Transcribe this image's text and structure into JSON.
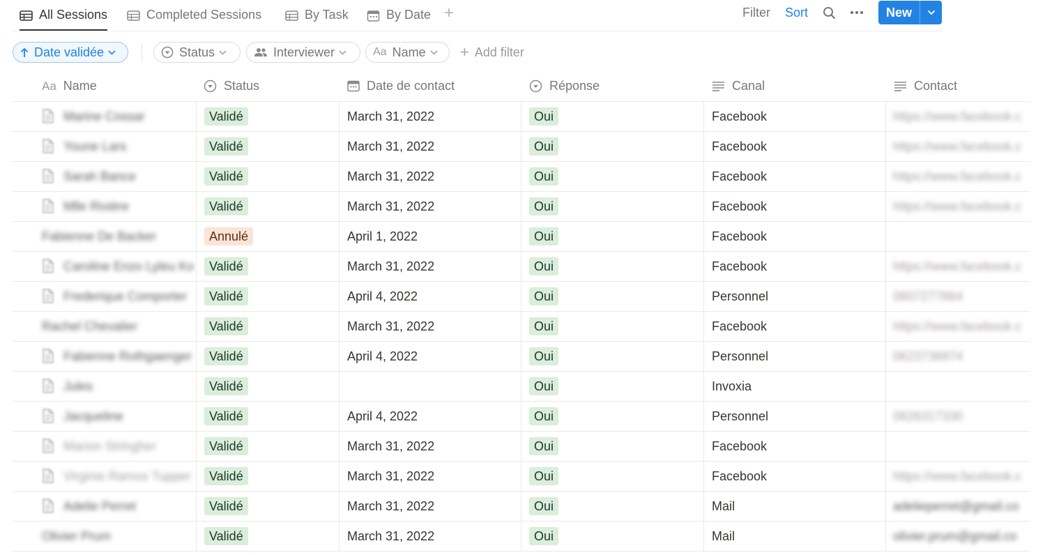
{
  "tabs": [
    {
      "label": "All Sessions",
      "active": true
    },
    {
      "label": "Completed Sessions",
      "active": false
    },
    {
      "label": "By Task",
      "active": false
    },
    {
      "label": "By Date",
      "active": false
    }
  ],
  "toolbar": {
    "filter_label": "Filter",
    "sort_label": "Sort",
    "new_label": "New"
  },
  "filters": {
    "sort_pill": "Date validée",
    "status_pill": "Status",
    "interviewer_pill": "Interviewer",
    "name_pill": "Name",
    "name_prefix": "Aa",
    "add_filter": "Add filter"
  },
  "columns": {
    "name": "Name",
    "name_prefix": "Aa",
    "status": "Status",
    "date": "Date de contact",
    "response": "Réponse",
    "channel": "Canal",
    "contact": "Contact"
  },
  "rows": [
    {
      "name": "Marine Cossar",
      "status": "Validé",
      "date": "March 31, 2022",
      "response": "Oui",
      "channel": "Facebook",
      "contact": "https://www.facebook.c"
    },
    {
      "name": "Youne Lars",
      "status": "Validé",
      "date": "March 31, 2022",
      "response": "Oui",
      "channel": "Facebook",
      "contact": "https://www.facebook.c"
    },
    {
      "name": "Sarah Bance",
      "status": "Validé",
      "date": "March 31, 2022",
      "response": "Oui",
      "channel": "Facebook",
      "contact": "https://www.facebook.c"
    },
    {
      "name": "Mlle Rivière",
      "status": "Validé",
      "date": "March 31, 2022",
      "response": "Oui",
      "channel": "Facebook",
      "contact": "https://www.facebook.c"
    },
    {
      "name": "Fabienne De Backer",
      "status": "Annulé",
      "date": "April 1, 2022",
      "response": "Oui",
      "channel": "Facebook",
      "contact": ""
    },
    {
      "name": "Caroline Enzo Lyleu Ko",
      "status": "Validé",
      "date": "March 31, 2022",
      "response": "Oui",
      "channel": "Facebook",
      "contact": "https://www.facebook.c"
    },
    {
      "name": "Frederique Comporter",
      "status": "Validé",
      "date": "April 4, 2022",
      "response": "Oui",
      "channel": "Personnel",
      "contact": "0607277864"
    },
    {
      "name": "Rachel Chevalier",
      "status": "Validé",
      "date": "March 31, 2022",
      "response": "Oui",
      "channel": "Facebook",
      "contact": "https://www.facebook.c"
    },
    {
      "name": "Fabienne Rothgaenger",
      "status": "Validé",
      "date": "April 4, 2022",
      "response": "Oui",
      "channel": "Personnel",
      "contact": "0623736874"
    },
    {
      "name": "Jules",
      "status": "Validé",
      "date": "",
      "response": "Oui",
      "channel": "Invoxia",
      "contact": ""
    },
    {
      "name": "Jacqueline",
      "status": "Validé",
      "date": "April 4, 2022",
      "response": "Oui",
      "channel": "Personnel",
      "contact": "0626317330"
    },
    {
      "name": "Marion Stringher",
      "status": "Validé",
      "date": "March 31, 2022",
      "response": "Oui",
      "channel": "Facebook",
      "contact": ""
    },
    {
      "name": "Virginie Ramos Tupper",
      "status": "Validé",
      "date": "March 31, 2022",
      "response": "Oui",
      "channel": "Facebook",
      "contact": "https://www.facebook.c"
    },
    {
      "name": "Adelie Perret",
      "status": "Validé",
      "date": "March 31, 2022",
      "response": "Oui",
      "channel": "Mail",
      "contact": "adelieperret@gmail.co"
    },
    {
      "name": "Olivier Prum",
      "status": "Validé",
      "date": "March 31, 2022",
      "response": "Oui",
      "channel": "Mail",
      "contact": "olivier.prum@gmail.co"
    }
  ],
  "colors": {
    "accent": "#2383e2",
    "tag_green": "#dbeddb",
    "tag_peach": "#fbe4d7"
  }
}
